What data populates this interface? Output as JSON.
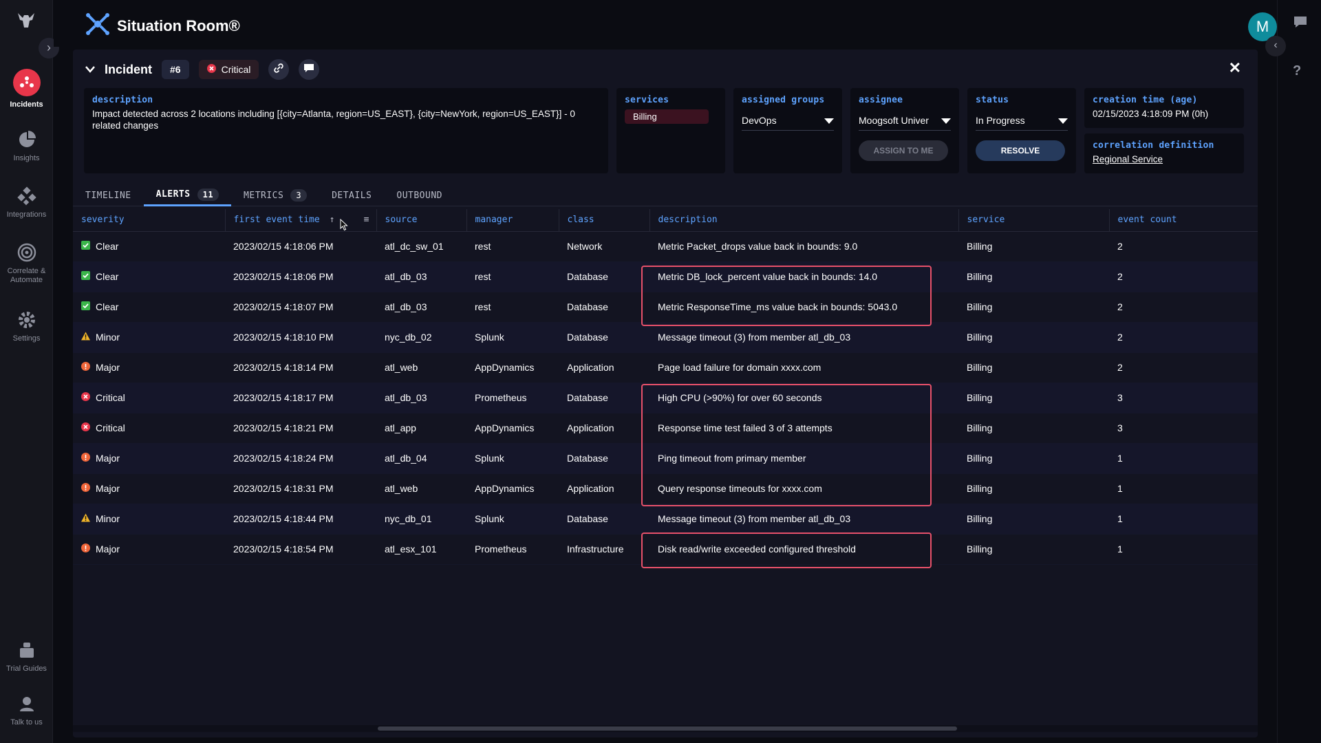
{
  "app": {
    "title": "Situation Room®",
    "avatar_letter": "M"
  },
  "nav": {
    "items": [
      {
        "label": "Incidents",
        "icon": "incidents-icon",
        "active": true
      },
      {
        "label": "Insights",
        "icon": "insights-icon"
      },
      {
        "label": "Integrations",
        "icon": "integrations-icon"
      },
      {
        "label": "Correlate & Automate",
        "icon": "correlate-icon"
      },
      {
        "label": "Settings",
        "icon": "gear-icon"
      },
      {
        "label": "Trial Guides",
        "icon": "guides-icon"
      },
      {
        "label": "Talk to us",
        "icon": "support-icon"
      }
    ]
  },
  "incident": {
    "title": "Incident",
    "number": "#6",
    "severity": "Critical",
    "description_label": "description",
    "description": "Impact detected across 2 locations including [{city=Atlanta, region=US_EAST}, {city=NewYork, region=US_EAST}] - 0 related changes",
    "services_label": "services",
    "service": "Billing",
    "groups_label": "assigned groups",
    "group": "DevOps",
    "assignee_label": "assignee",
    "assignee": "Moogsoft Univer",
    "assign_btn": "ASSIGN TO ME",
    "status_label": "status",
    "status": "In Progress",
    "resolve_btn": "RESOLVE",
    "creation_label": "creation time (age)",
    "creation": "02/15/2023 4:18:09 PM (0h)",
    "correlation_label": "correlation definition",
    "correlation": "Regional Service"
  },
  "tabs": [
    {
      "label": "TIMELINE"
    },
    {
      "label": "ALERTS",
      "count": "11",
      "active": true
    },
    {
      "label": "METRICS",
      "count": "3"
    },
    {
      "label": "DETAILS"
    },
    {
      "label": "OUTBOUND"
    }
  ],
  "columns": [
    "severity",
    "first event time",
    "source",
    "manager",
    "class",
    "description",
    "service",
    "event count"
  ],
  "rows": [
    {
      "severity": "Clear",
      "time": "2023/02/15 4:18:06 PM",
      "source": "atl_dc_sw_01",
      "manager": "rest",
      "class": "Network",
      "description": "Metric Packet_drops value back in bounds: 9.0",
      "service": "Billing",
      "count": "2"
    },
    {
      "severity": "Clear",
      "time": "2023/02/15 4:18:06 PM",
      "source": "atl_db_03",
      "manager": "rest",
      "class": "Database",
      "description": "Metric DB_lock_percent value back in bounds: 14.0",
      "service": "Billing",
      "count": "2"
    },
    {
      "severity": "Clear",
      "time": "2023/02/15 4:18:07 PM",
      "source": "atl_db_03",
      "manager": "rest",
      "class": "Database",
      "description": "Metric ResponseTime_ms value back in bounds: 5043.0",
      "service": "Billing",
      "count": "2"
    },
    {
      "severity": "Minor",
      "time": "2023/02/15 4:18:10 PM",
      "source": "nyc_db_02",
      "manager": "Splunk",
      "class": "Database",
      "description": "Message timeout (3) from member atl_db_03",
      "service": "Billing",
      "count": "2"
    },
    {
      "severity": "Major",
      "time": "2023/02/15 4:18:14 PM",
      "source": "atl_web",
      "manager": "AppDynamics",
      "class": "Application",
      "description": "Page load failure for domain xxxx.com",
      "service": "Billing",
      "count": "2"
    },
    {
      "severity": "Critical",
      "time": "2023/02/15 4:18:17 PM",
      "source": "atl_db_03",
      "manager": "Prometheus",
      "class": "Database",
      "description": "High CPU (>90%) for over 60 seconds",
      "service": "Billing",
      "count": "3"
    },
    {
      "severity": "Critical",
      "time": "2023/02/15 4:18:21 PM",
      "source": "atl_app",
      "manager": "AppDynamics",
      "class": "Application",
      "description": "Response time test failed 3 of 3 attempts",
      "service": "Billing",
      "count": "3"
    },
    {
      "severity": "Major",
      "time": "2023/02/15 4:18:24 PM",
      "source": "atl_db_04",
      "manager": "Splunk",
      "class": "Database",
      "description": "Ping timeout from primary member",
      "service": "Billing",
      "count": "1"
    },
    {
      "severity": "Major",
      "time": "2023/02/15 4:18:31 PM",
      "source": "atl_web",
      "manager": "AppDynamics",
      "class": "Application",
      "description": "Query response timeouts for xxxx.com",
      "service": "Billing",
      "count": "1"
    },
    {
      "severity": "Minor",
      "time": "2023/02/15 4:18:44 PM",
      "source": "nyc_db_01",
      "manager": "Splunk",
      "class": "Database",
      "description": "Message timeout (3) from member atl_db_03",
      "service": "Billing",
      "count": "1"
    },
    {
      "severity": "Major",
      "time": "2023/02/15 4:18:54 PM",
      "source": "atl_esx_101",
      "manager": "Prometheus",
      "class": "Infrastructure",
      "description": "Disk read/write exceeded configured threshold",
      "service": "Billing",
      "count": "1"
    }
  ],
  "colors": {
    "accent": "#5ea3ff",
    "critical": "#e8364a",
    "major": "#f0663a",
    "minor": "#f0b429",
    "clear": "#3bb54a",
    "highlight": "#e8516a"
  }
}
